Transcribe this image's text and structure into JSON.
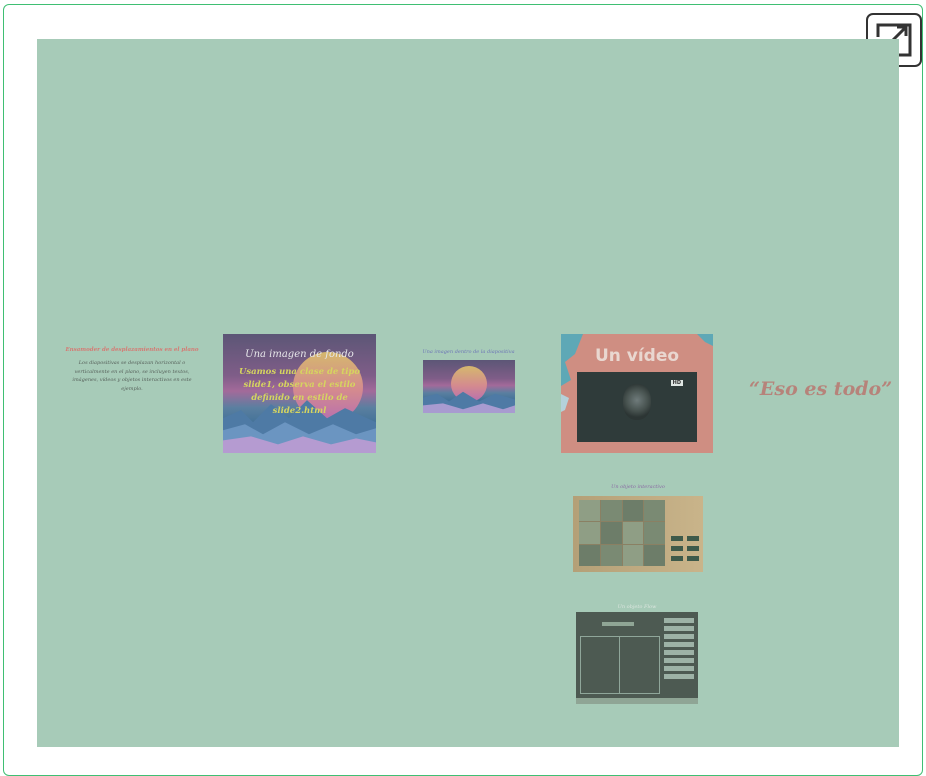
{
  "colors": {
    "border": "#3fbf73",
    "canvas": "#a7cbb8",
    "red_title": "#d47b74",
    "video_bg": "#cf8e82",
    "eso": "#b6837a"
  },
  "toolbar": {
    "expand_icon": "expand-icon"
  },
  "slides": {
    "intro": {
      "title": "Ensamoder de desplazamientos en el plano",
      "body": "Los diapositivas se desplazan horizontal o verticalmente en el plano, se incluyen textos, imágenes, vídeos y objetos interactivos en este ejemplo."
    },
    "background": {
      "title": "Una imagen de fondo",
      "body": "Usamos una clase de tipo slide1, observa el estilo definido en estilo de slide2.html"
    },
    "image_slide": {
      "title": "Una imagen dentro de la diapositiva"
    },
    "video": {
      "title": "Un vídeo",
      "badge": "HD"
    },
    "ending": {
      "text": "“Eso es todo”"
    },
    "puzzle": {
      "title": "Un objeto interactivo"
    },
    "geogebra": {
      "title": "Un objeto Flow"
    }
  }
}
